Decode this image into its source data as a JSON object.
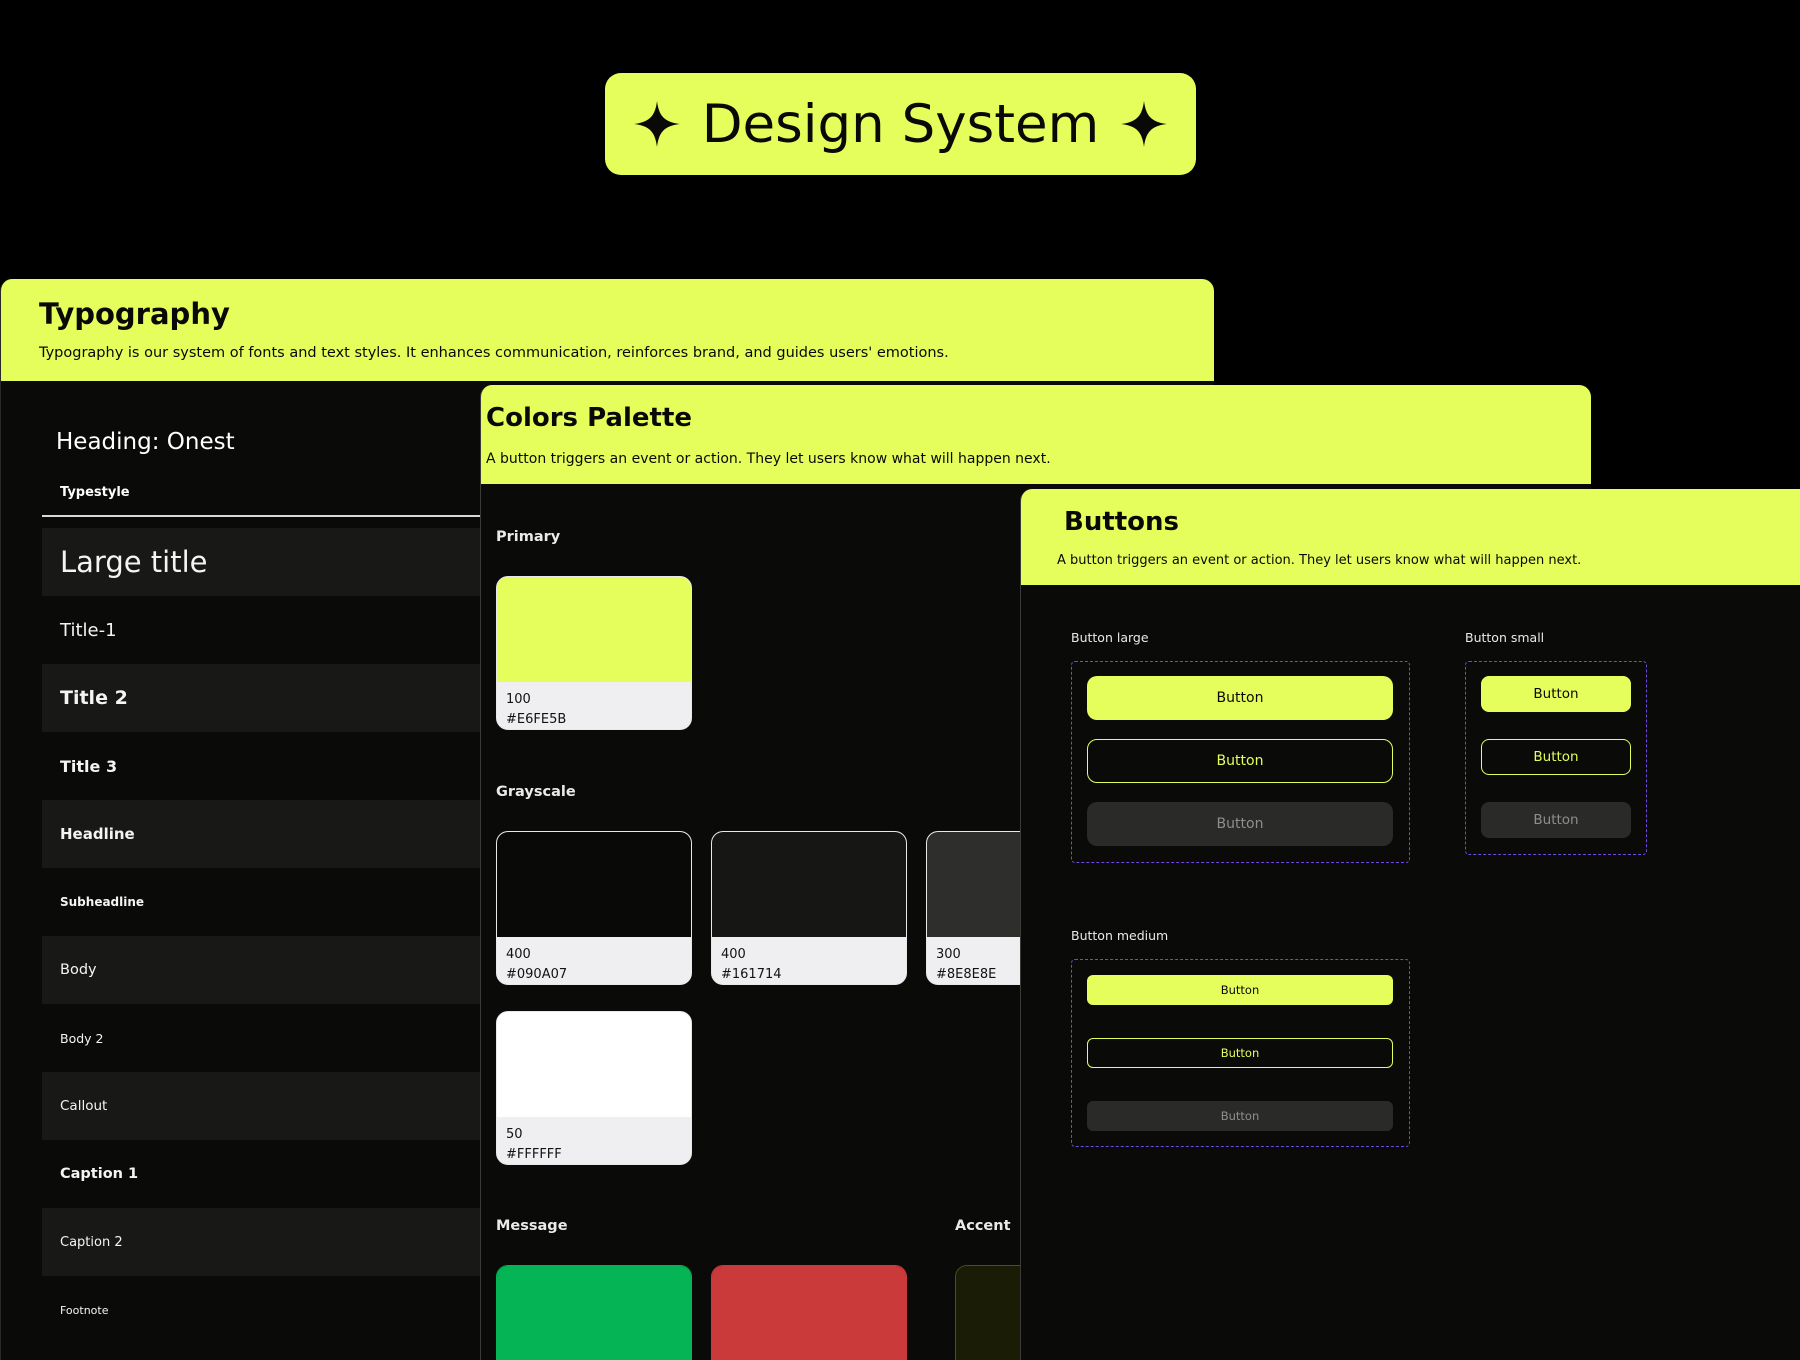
{
  "hero": {
    "title": "Design System",
    "star_icon": "four-point-star-icon"
  },
  "colors_theme": {
    "accent": "#E6FE5B",
    "background": "#090A07",
    "panel": "#0A0A09",
    "dashed_outline": "#6E4ADF"
  },
  "typography": {
    "title": "Typography",
    "description": "Typography is our system of fonts and text styles. It enhances communication, reinforces brand, and guides users' emotions.",
    "heading": "Heading: Onest",
    "column_header": "Typestyle",
    "rows": [
      "Large title",
      "Title-1",
      "Title 2",
      "Title 3",
      "Headline",
      "Subheadline",
      "Body",
      "Body 2",
      "Callout",
      "Caption 1",
      "Caption 2",
      "Footnote"
    ]
  },
  "palette": {
    "title": "Colors Palette",
    "description": "A button triggers an event or action. They let users know what will happen next.",
    "primary_label": "Primary",
    "grayscale_label": "Grayscale",
    "message_label": "Message",
    "accent_label": "Accent",
    "primary": [
      {
        "weight": "100",
        "hex": "#E6FE5B"
      }
    ],
    "grayscale": [
      {
        "weight": "400",
        "hex": "#090A07"
      },
      {
        "weight": "400",
        "hex": "#161714"
      },
      {
        "weight": "300",
        "hex": "#8E8E8E"
      },
      {
        "weight": "50",
        "hex": "#FFFFFF"
      }
    ],
    "message_colors": [
      "#05B454",
      "#CB3A3A"
    ],
    "accent_color": "#1A1C05"
  },
  "buttons": {
    "title": "Buttons",
    "description": "A button triggers an event or action. They let users know what will happen next.",
    "large_label": "Button large",
    "small_label": "Button small",
    "medium_label": "Button medium",
    "button_text": "Button"
  }
}
